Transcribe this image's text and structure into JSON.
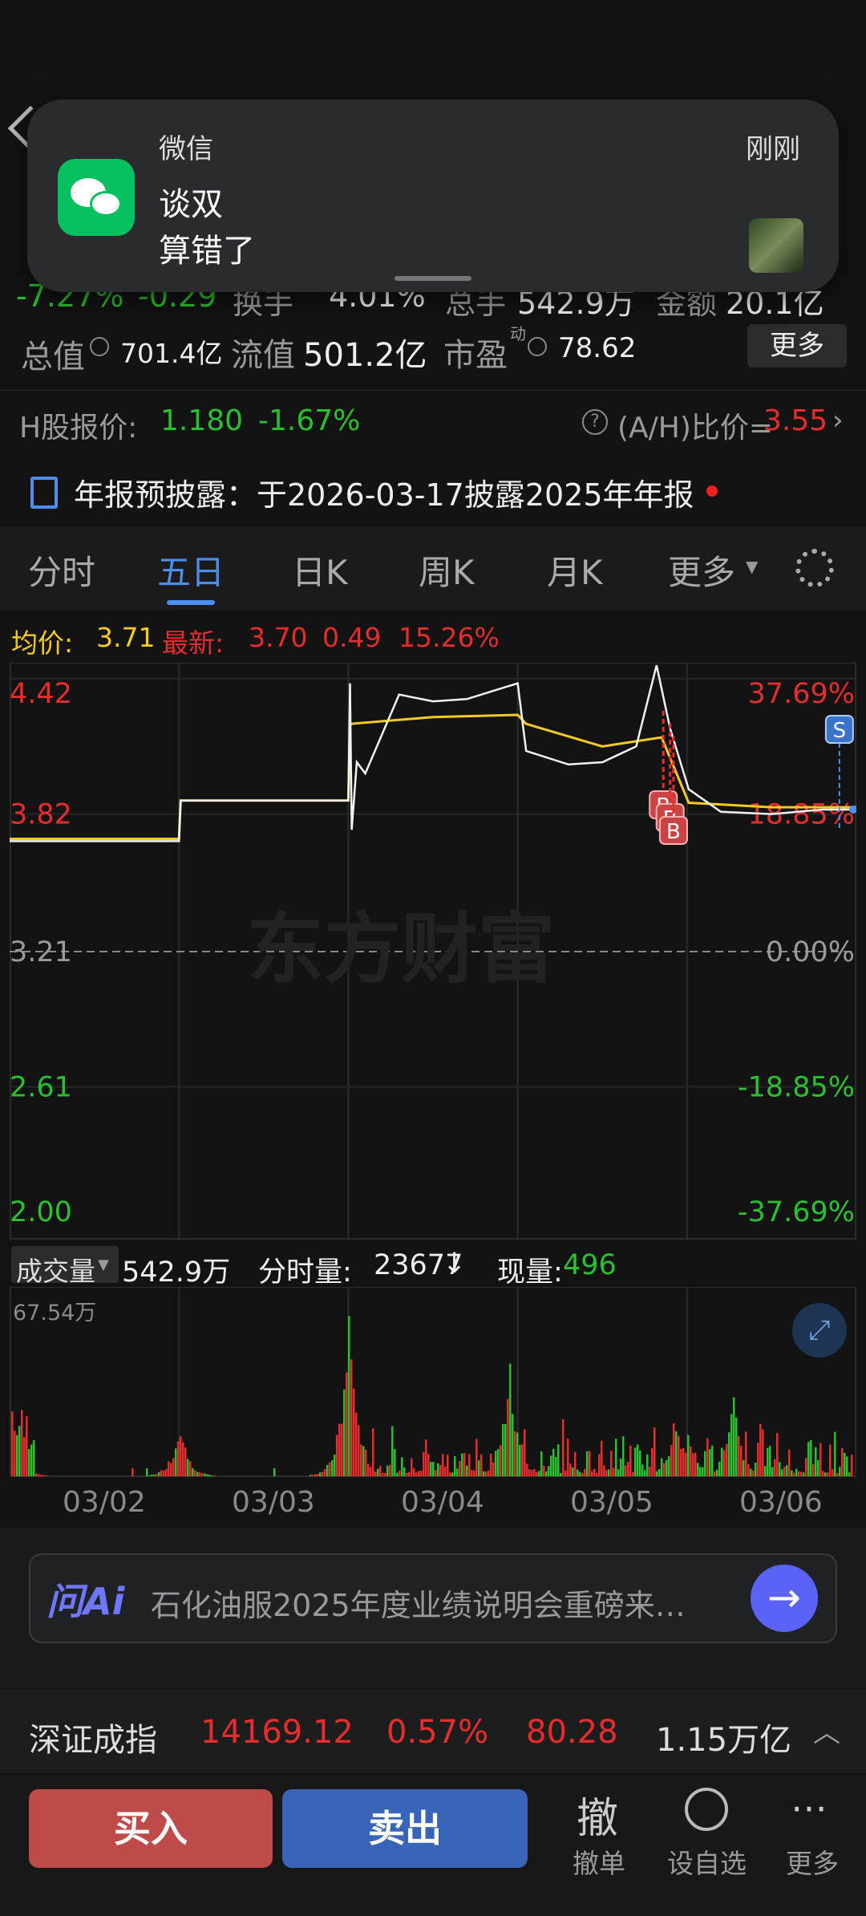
{
  "notification": {
    "app": "微信",
    "time": "刚刚",
    "sender": "谈双",
    "message": "算错了"
  },
  "quote": {
    "change_pct": "-7.27%",
    "change": "-0.29",
    "turnover_label": "换手",
    "turnover": "4.01%",
    "volume_label": "总手",
    "volume": "542.9万",
    "amount_label": "金额",
    "amount": "20.1亿",
    "total_value_label": "总值",
    "total_value": "701.4亿",
    "float_value_label": "流值",
    "float_value": "501.2亿",
    "pe_label": "市盈",
    "pe_sup": "动",
    "pe": "78.62",
    "more_label": "更多"
  },
  "h_share": {
    "label": "H股报价:",
    "price": "1.180",
    "pct": "-1.67%",
    "ratio_label": "(A/H)比价=",
    "ratio": "3.55"
  },
  "announcement": {
    "text": "年报预披露：于2026-03-17披露2025年年报"
  },
  "tabs": [
    "分时",
    "五日",
    "日K",
    "周K",
    "月K",
    "更多"
  ],
  "active_tab": "五日",
  "legend": {
    "avg_label": "均价:",
    "avg": "3.71",
    "latest_label": "最新:",
    "latest": "3.70",
    "latest_change": "0.49",
    "latest_pct": "15.26%"
  },
  "colors": {
    "up": "#e52d2d",
    "down": "#29c12f",
    "avg": "#f5cb1e",
    "accent": "#4c8ff0"
  },
  "chart_data": {
    "type": "line",
    "y_ticks_left": [
      "4.42",
      "3.82",
      "3.21",
      "2.61",
      "2.00"
    ],
    "y_ticks_right": [
      "37.69%",
      "18.85%",
      "0.00%",
      "-18.85%",
      "-37.69%"
    ],
    "ylim": [
      2.0,
      4.42
    ],
    "baseline": 3.21,
    "x": [
      "03/02",
      "03/03",
      "03/04",
      "03/05",
      "03/06"
    ],
    "series": [
      {
        "name": "最新",
        "values": [
          [
            0,
            3.7
          ],
          [
            0.5,
            3.7
          ],
          [
            1.0,
            3.7
          ],
          [
            1.01,
            3.88
          ],
          [
            1.5,
            3.88
          ],
          [
            2.0,
            3.88
          ],
          [
            2.01,
            4.4
          ],
          [
            2.02,
            3.75
          ],
          [
            2.05,
            4.05
          ],
          [
            2.1,
            4.0
          ],
          [
            2.3,
            4.35
          ],
          [
            2.5,
            4.32
          ],
          [
            2.7,
            4.33
          ],
          [
            3.0,
            4.4
          ],
          [
            3.05,
            4.1
          ],
          [
            3.3,
            4.04
          ],
          [
            3.5,
            4.05
          ],
          [
            3.7,
            4.12
          ],
          [
            3.82,
            4.48
          ],
          [
            3.9,
            4.2
          ],
          [
            4.01,
            3.93
          ],
          [
            4.2,
            3.83
          ],
          [
            4.5,
            3.82
          ],
          [
            4.8,
            3.84
          ],
          [
            5.0,
            3.84
          ]
        ]
      },
      {
        "name": "均价",
        "values": [
          [
            0,
            3.71
          ],
          [
            1.0,
            3.71
          ],
          [
            1.01,
            3.88
          ],
          [
            2.0,
            3.88
          ],
          [
            2.01,
            4.22
          ],
          [
            2.5,
            4.25
          ],
          [
            3.0,
            4.26
          ],
          [
            3.05,
            4.22
          ],
          [
            3.5,
            4.12
          ],
          [
            3.85,
            4.16
          ],
          [
            4.01,
            3.87
          ],
          [
            4.5,
            3.85
          ],
          [
            5.0,
            3.85
          ]
        ]
      }
    ],
    "markers": [
      {
        "label": "B",
        "x": 3.86
      },
      {
        "label": "B",
        "x": 3.9
      },
      {
        "label": "B",
        "x": 3.92
      },
      {
        "label": "S",
        "x": 4.9
      }
    ],
    "watermark": "东方财富"
  },
  "volume": {
    "menu_label": "成交量",
    "total": "542.9万",
    "minute_label": "分时量:",
    "minute": "23677",
    "current_label": "现量:",
    "current": "496",
    "max_label": "67.54万"
  },
  "ai_bar": {
    "logo": "问Ai",
    "text": "石化油服2025年度业绩说明会重磅来…"
  },
  "index": {
    "name": "深证成指",
    "value": "14169.12",
    "pct": "0.57%",
    "change": "80.28",
    "amount": "1.15万亿"
  },
  "actions": {
    "buy": "买入",
    "sell": "卖出",
    "cancel_icon": "撤",
    "cancel": "撤单",
    "watch": "设自选",
    "more": "更多"
  }
}
